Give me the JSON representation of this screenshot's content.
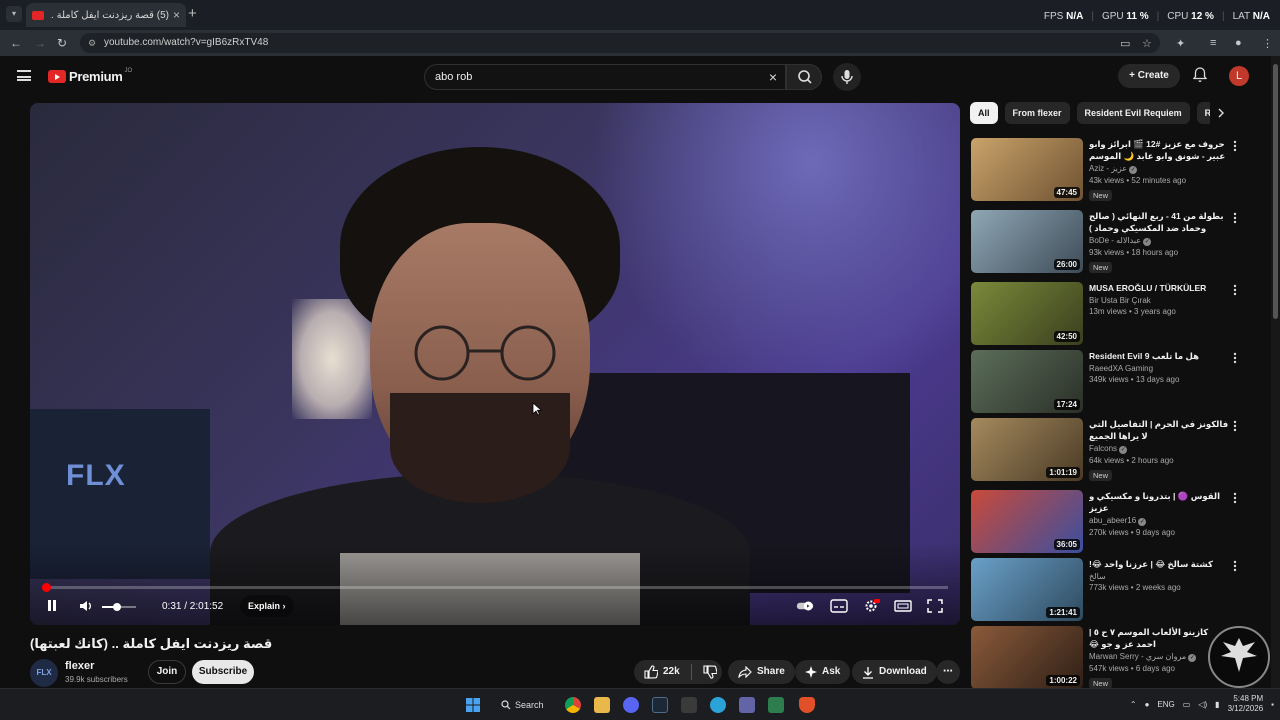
{
  "browser": {
    "tab_title": "(5) قصة ريزدنت ايفل كاملة ..",
    "url": "youtube.com/watch?v=gIB6zRxTV48",
    "perf": [
      {
        "label": "FPS",
        "value": "N/A"
      },
      {
        "label": "GPU",
        "value": "11 %"
      },
      {
        "label": "CPU",
        "value": "12 %"
      },
      {
        "label": "LAT",
        "value": "N/A"
      }
    ]
  },
  "masthead": {
    "logo": "Premium",
    "logo_sup": "JO",
    "search_value": "abo rob",
    "create_label": "Create",
    "avatar_letter": "L"
  },
  "player": {
    "progress": 0.004,
    "volume": 0.45,
    "current_time": "0:31",
    "duration": "2:01:52",
    "time_display": "0:31 / 2:01:52",
    "explain_label": "Explain",
    "overlay_logo": "FLX"
  },
  "video": {
    "title": "قصة ريزدنت ايفل كاملة .. (كانك لعبتها)",
    "channel": "flexer",
    "channel_avatar_text": "FLX",
    "subscribers": "39.9k subscribers",
    "join_label": "Join",
    "subscribe_label": "Subscribe",
    "likes": "22k",
    "share_label": "Share",
    "ask_label": "Ask",
    "download_label": "Download"
  },
  "sidebar": {
    "chips": [
      "All",
      "From flexer",
      "Resident Evil Requiem",
      "Re"
    ],
    "items": [
      {
        "title": "حروف مع عزيز #12 🎬 ابرائز وابو عبير - شونق وابو عابد 🌙 الموسم الثالث",
        "channel": "Aziz - عزيز",
        "verified": true,
        "stats": "43k views • 52 minutes ago",
        "new": "New",
        "duration": "47:45",
        "c1": "#c9a36a",
        "c2": "#6f5232"
      },
      {
        "title": "بطولة من 41 - ربع النهائي ( صالح وحماد ضد المكسيكي وحماد )",
        "channel": "BoDe - عبدالاله",
        "verified": true,
        "stats": "93k views • 18 hours ago",
        "new": "New",
        "duration": "26:00",
        "c1": "#8fa7b5",
        "c2": "#3e4b57"
      },
      {
        "title": "MUSA EROĞLU / TÜRKÜLER",
        "channel": "Bir Usta Bir Çırak",
        "verified": false,
        "stats": "13m views • 3 years ago",
        "new": "",
        "duration": "42:50",
        "c1": "#7a8a3a",
        "c2": "#3a3f1e"
      },
      {
        "title": "Resident Evil 9 هل ما تلعب",
        "channel": "RaeedXA Gaming",
        "verified": false,
        "stats": "349k views • 13 days ago",
        "new": "",
        "duration": "17:24",
        "c1": "#5c6e5a",
        "c2": "#2a3028"
      },
      {
        "title": "فالكونز في الحرم | التفاصيل التي لا يراها الجميع",
        "channel": "Falcons",
        "verified": true,
        "stats": "64k views • 2 hours ago",
        "new": "New",
        "duration": "1:01:19",
        "c1": "#a58a5e",
        "c2": "#4a3a25"
      },
      {
        "title": "القوس 🟣 | بتدرونا و مكسيكي و عزيز",
        "channel": "abu_abeer16",
        "verified": true,
        "stats": "270k views • 9 days ago",
        "new": "",
        "duration": "36:05",
        "c1": "#c94a3a",
        "c2": "#3a4fa0"
      },
      {
        "title": "كشتة سالخ 😂 | عرزنا واحد 😂!",
        "channel": "سالخ",
        "verified": false,
        "stats": "773k views • 2 weeks ago",
        "new": "",
        "duration": "1:21:41",
        "c1": "#6aa0c8",
        "c2": "#2e4a5e"
      },
      {
        "title": "كازينو الألعاب الموسم ٧ ح ٥ | احمد عز و جو 😂",
        "channel": "Marwan Serry - مروان سري",
        "verified": true,
        "stats": "547k views • 6 days ago",
        "new": "New",
        "duration": "1:00:22",
        "c1": "#8b5a3a",
        "c2": "#2e1f16"
      }
    ]
  },
  "taskbar": {
    "search_label": "Search",
    "lang": "ENG",
    "time": "5:48 PM",
    "date": "3/12/2026"
  },
  "colors": {
    "accent_red": "#ff0000",
    "bg": "#0f0f0f",
    "chip_bg": "#272727"
  }
}
